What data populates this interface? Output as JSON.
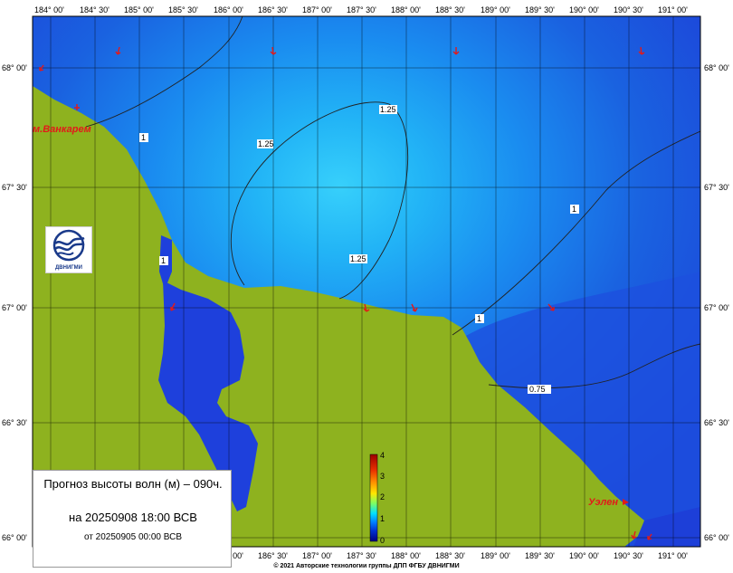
{
  "map": {
    "lon_labels": [
      "184° 00'",
      "184° 30'",
      "185° 00'",
      "185° 30'",
      "186° 00'",
      "186° 30'",
      "187° 00'",
      "187° 30'",
      "188° 00'",
      "188° 30'",
      "189° 00'",
      "189° 30'",
      "190° 00'",
      "190° 30'",
      "191° 00'"
    ],
    "lat_labels": [
      "68° 00'",
      "67° 30'",
      "67° 00'",
      "66° 30'",
      "66° 00'"
    ],
    "places": {
      "vankarem": "м.Ванкарем",
      "uelen": "Уэлен"
    },
    "contours": {
      "c1a": "1",
      "c1b": "1",
      "c1c": "1",
      "c1d": "1",
      "c125a": "1.25",
      "c125b": "1.25",
      "c125c": "1.25",
      "c075": "0.75"
    }
  },
  "colorbar": {
    "ticks": [
      "4",
      "3",
      "2",
      "1",
      "0"
    ],
    "colors": [
      "#9b0000",
      "#e83000",
      "#ff9000",
      "#ffe800",
      "#80ff60",
      "#00e0ff",
      "#0080ff",
      "#0030d0",
      "#000080"
    ]
  },
  "legend": {
    "title": "Прогноз высоты волн (м) – 090ч.",
    "valid": "на 20250908 18:00 ВСВ",
    "issued": "от 20250905 00:00 ВСВ"
  },
  "logo": {
    "text": "ДВНИГМИ"
  },
  "footer": {
    "copyright": "© 2021 Авторские технологии группы ДПП ФГБУ ДВНИГМИ"
  },
  "colors": {
    "land": "#8eb21f",
    "sea_deep": "#1d3fd8",
    "sea_mid": "#1a78ee",
    "sea_light": "#22b4f6",
    "arrow": "#e21a1a"
  }
}
